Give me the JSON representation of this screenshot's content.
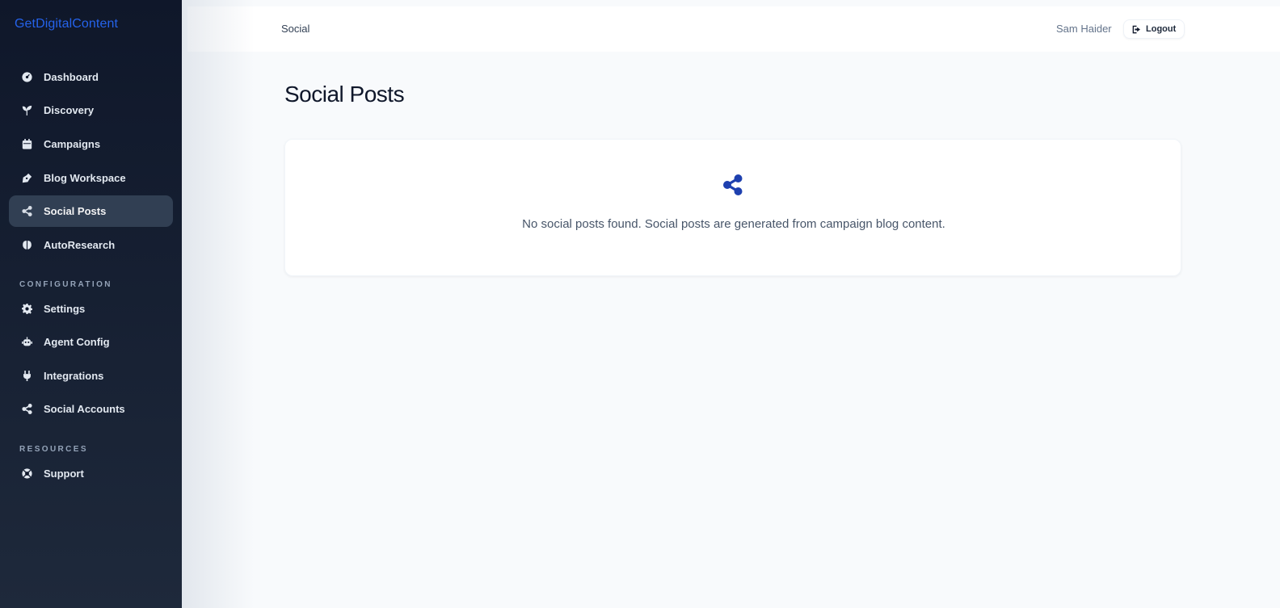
{
  "brand": "GetDigitalContent",
  "sidebar": {
    "items": [
      {
        "label": "Dashboard",
        "icon": "gauge-icon"
      },
      {
        "label": "Discovery",
        "icon": "seedling-icon"
      },
      {
        "label": "Campaigns",
        "icon": "calendar-icon"
      },
      {
        "label": "Blog Workspace",
        "icon": "pen-nib-icon"
      },
      {
        "label": "Social Posts",
        "icon": "share-icon",
        "active": true
      },
      {
        "label": "AutoResearch",
        "icon": "brain-icon"
      }
    ],
    "config_label": "CONFIGURATION",
    "config_items": [
      {
        "label": "Settings",
        "icon": "gear-icon"
      },
      {
        "label": "Agent Config",
        "icon": "robot-icon"
      },
      {
        "label": "Integrations",
        "icon": "plug-icon"
      },
      {
        "label": "Social Accounts",
        "icon": "share-icon"
      }
    ],
    "resources_label": "RESOURCES",
    "resources_items": [
      {
        "label": "Support",
        "icon": "life-ring-icon"
      }
    ]
  },
  "header": {
    "breadcrumb": "Social",
    "user_name": "Sam Haider",
    "logout_label": "Logout"
  },
  "main": {
    "title": "Social Posts",
    "empty_message": "No social posts found. Social posts are generated from campaign blog content."
  },
  "colors": {
    "brand": "#2563eb",
    "accent_icon": "#1e40af",
    "sidebar_bg": "#0f172a"
  }
}
